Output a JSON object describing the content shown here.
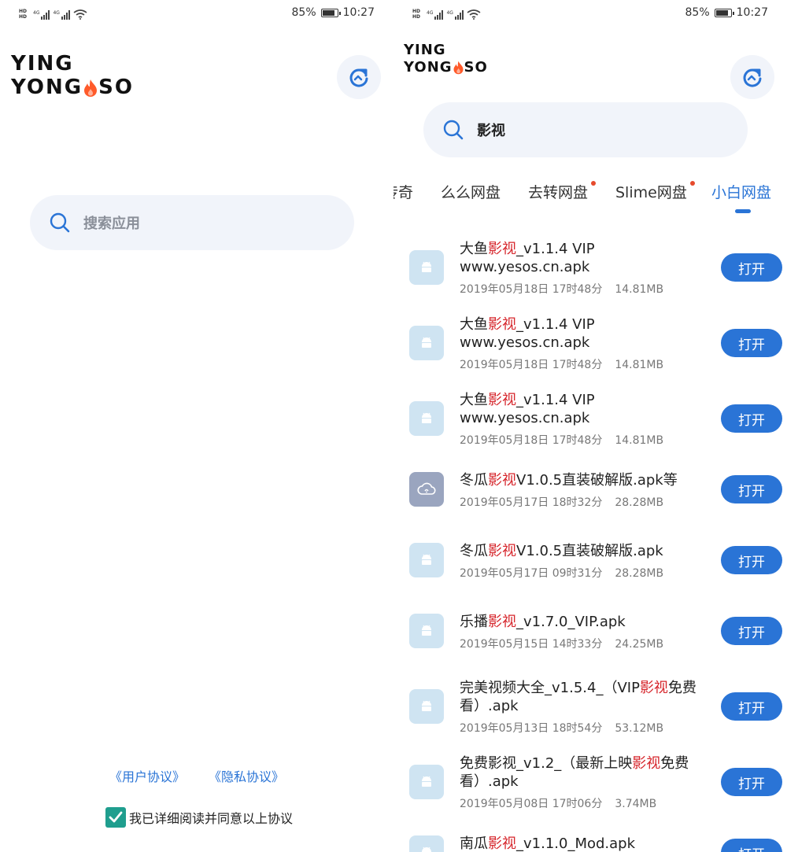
{
  "status_bar": {
    "network_labels": [
      "4G",
      "4G"
    ],
    "battery": "85%",
    "battery_level": 0.85,
    "time": "10:27"
  },
  "logo": {
    "line1": "YING",
    "line2_a": "YONG",
    "line2_b": "SO",
    "flame_color": "#ff5a2a"
  },
  "left_screen": {
    "search_placeholder": "搜索应用",
    "agreements": [
      "《用户协议》",
      "《隐私协议》"
    ],
    "consent_text": "我已详细阅读并同意以上协议",
    "consent_checked": true
  },
  "right_screen": {
    "search_query": "影视",
    "tabs": [
      {
        "label": "传奇",
        "dot": false,
        "active": false
      },
      {
        "label": "么么网盘",
        "dot": false,
        "active": false
      },
      {
        "label": "去转网盘",
        "dot": true,
        "active": false
      },
      {
        "label": "Slime网盘",
        "dot": true,
        "active": false
      },
      {
        "label": "小白网盘",
        "dot": false,
        "active": true
      }
    ],
    "open_label": "打开",
    "results": [
      {
        "title_pre": "大鱼",
        "title_hl": "影视",
        "title_post": "_v1.1.4 VIP www.yesos.cn.apk",
        "date": "2019年05月18日 17时48分",
        "size": "14.81MB",
        "icon": "android-icon"
      },
      {
        "title_pre": "大鱼",
        "title_hl": "影视",
        "title_post": "_v1.1.4 VIP www.yesos.cn.apk",
        "date": "2019年05月18日 17时48分",
        "size": "14.81MB",
        "icon": "android-icon"
      },
      {
        "title_pre": "大鱼",
        "title_hl": "影视",
        "title_post": "_v1.1.4 VIP www.yesos.cn.apk",
        "date": "2019年05月18日 17时48分",
        "size": "14.81MB",
        "icon": "android-icon"
      },
      {
        "title_pre": "冬瓜",
        "title_hl": "影视",
        "title_post": "V1.0.5直装破解版.apk等",
        "date": "2019年05月17日 18时32分",
        "size": "28.28MB",
        "icon": "cloud-icon"
      },
      {
        "title_pre": "冬瓜",
        "title_hl": "影视",
        "title_post": "V1.0.5直装破解版.apk",
        "date": "2019年05月17日 09时31分",
        "size": "28.28MB",
        "icon": "android-icon"
      },
      {
        "title_pre": "乐播",
        "title_hl": "影视",
        "title_post": "_v1.7.0_VIP.apk",
        "date": "2019年05月15日 14时33分",
        "size": "24.25MB",
        "icon": "android-icon"
      },
      {
        "title_pre": "完美视频大全_v1.5.4_（VIP",
        "title_hl": "影视",
        "title_post": "免费看）.apk",
        "date": "2019年05月13日 18时54分",
        "size": "53.12MB",
        "icon": "android-icon"
      },
      {
        "title_pre": "免费影视_v1.2_（最新上映",
        "title_hl": "影视",
        "title_post": "免费看）.apk",
        "date": "2019年05月08日 17时06分",
        "size": "3.74MB",
        "icon": "android-icon"
      },
      {
        "title_pre": "南瓜",
        "title_hl": "影视",
        "title_post": "_v1.1.0_Mod.apk",
        "date": "",
        "size": "",
        "icon": "android-icon"
      }
    ]
  }
}
